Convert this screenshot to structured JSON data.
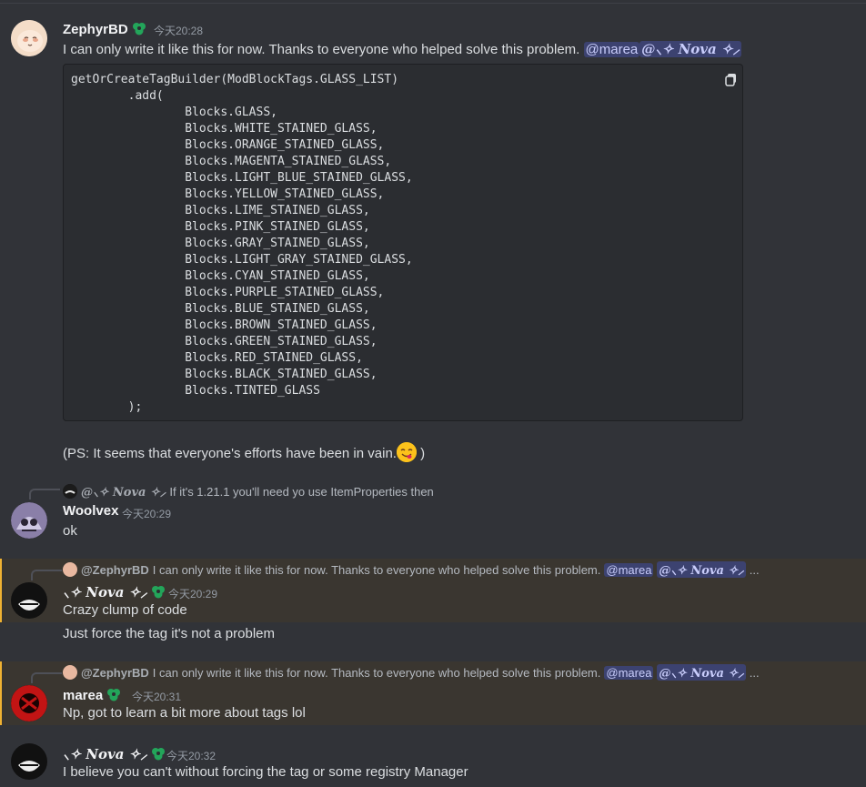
{
  "messages": {
    "zephyr": {
      "author": "ZephyrBD",
      "timestamp": "今天20:28",
      "text": "I can only write it like this for now. Thanks to everyone who helped solve this problem.",
      "mentions": [
        "@marea",
        "@⸜✧ 𝑵𝒐𝒗𝒂 ✧⸝"
      ],
      "code": "getOrCreateTagBuilder(ModBlockTags.GLASS_LIST)\n        .add(\n                Blocks.GLASS,\n                Blocks.WHITE_STAINED_GLASS,\n                Blocks.ORANGE_STAINED_GLASS,\n                Blocks.MAGENTA_STAINED_GLASS,\n                Blocks.LIGHT_BLUE_STAINED_GLASS,\n                Blocks.YELLOW_STAINED_GLASS,\n                Blocks.LIME_STAINED_GLASS,\n                Blocks.PINK_STAINED_GLASS,\n                Blocks.GRAY_STAINED_GLASS,\n                Blocks.LIGHT_GRAY_STAINED_GLASS,\n                Blocks.CYAN_STAINED_GLASS,\n                Blocks.PURPLE_STAINED_GLASS,\n                Blocks.BLUE_STAINED_GLASS,\n                Blocks.BROWN_STAINED_GLASS,\n                Blocks.GREEN_STAINED_GLASS,\n                Blocks.RED_STAINED_GLASS,\n                Blocks.BLACK_STAINED_GLASS,\n                Blocks.TINTED_GLASS\n        );",
      "ps_text": "(PS: It seems that everyone's efforts have been in vain.",
      "ps_close": " )",
      "emoji": "yum-emoji"
    },
    "woolvex": {
      "reply_to": "@⸜✧ 𝑵𝒐𝒗𝒂 ✧⸝",
      "reply_text": "If it's 1.21.1 you'll need yo use ItemProperties then",
      "author": "Woolvex",
      "timestamp": "今天20:29",
      "text": "ok"
    },
    "nova1": {
      "reply_to": "@ZephyrBD",
      "reply_text": "I can only write it like this for now. Thanks to everyone who helped solve this problem.",
      "reply_mentions": [
        "@marea",
        "@⸜✧ 𝑵𝒐𝒗𝒂 ✧⸝"
      ],
      "reply_more": "...",
      "author": "⸜✧ 𝑵𝒐𝒗𝒂 ✧⸝",
      "timestamp": "今天20:29",
      "text": "Crazy clump of code",
      "followup": "Just force the tag it's not a problem"
    },
    "marea": {
      "reply_to": "@ZephyrBD",
      "reply_text": "I can only write it like this for now. Thanks to everyone who helped solve this problem.",
      "reply_mentions": [
        "@marea",
        "@⸜✧ 𝑵𝒐𝒗𝒂 ✧⸝"
      ],
      "reply_more": "...",
      "author": "marea",
      "timestamp": "今天20:31",
      "text": "Np, got to learn a bit more about tags lol"
    },
    "nova2": {
      "author": "⸜✧ 𝑵𝒐𝒗𝒂 ✧⸝",
      "timestamp": "今天20:32",
      "text": "I believe you can't without forcing the tag or some registry Manager"
    }
  },
  "colors": {
    "background": "#313338",
    "mention_bg": "#3c4270",
    "highlight_bg": "#3a3630",
    "badge_green": "#23a55a"
  },
  "icons": {
    "badge": "leaf-badge-icon",
    "copy": "copy-icon"
  }
}
